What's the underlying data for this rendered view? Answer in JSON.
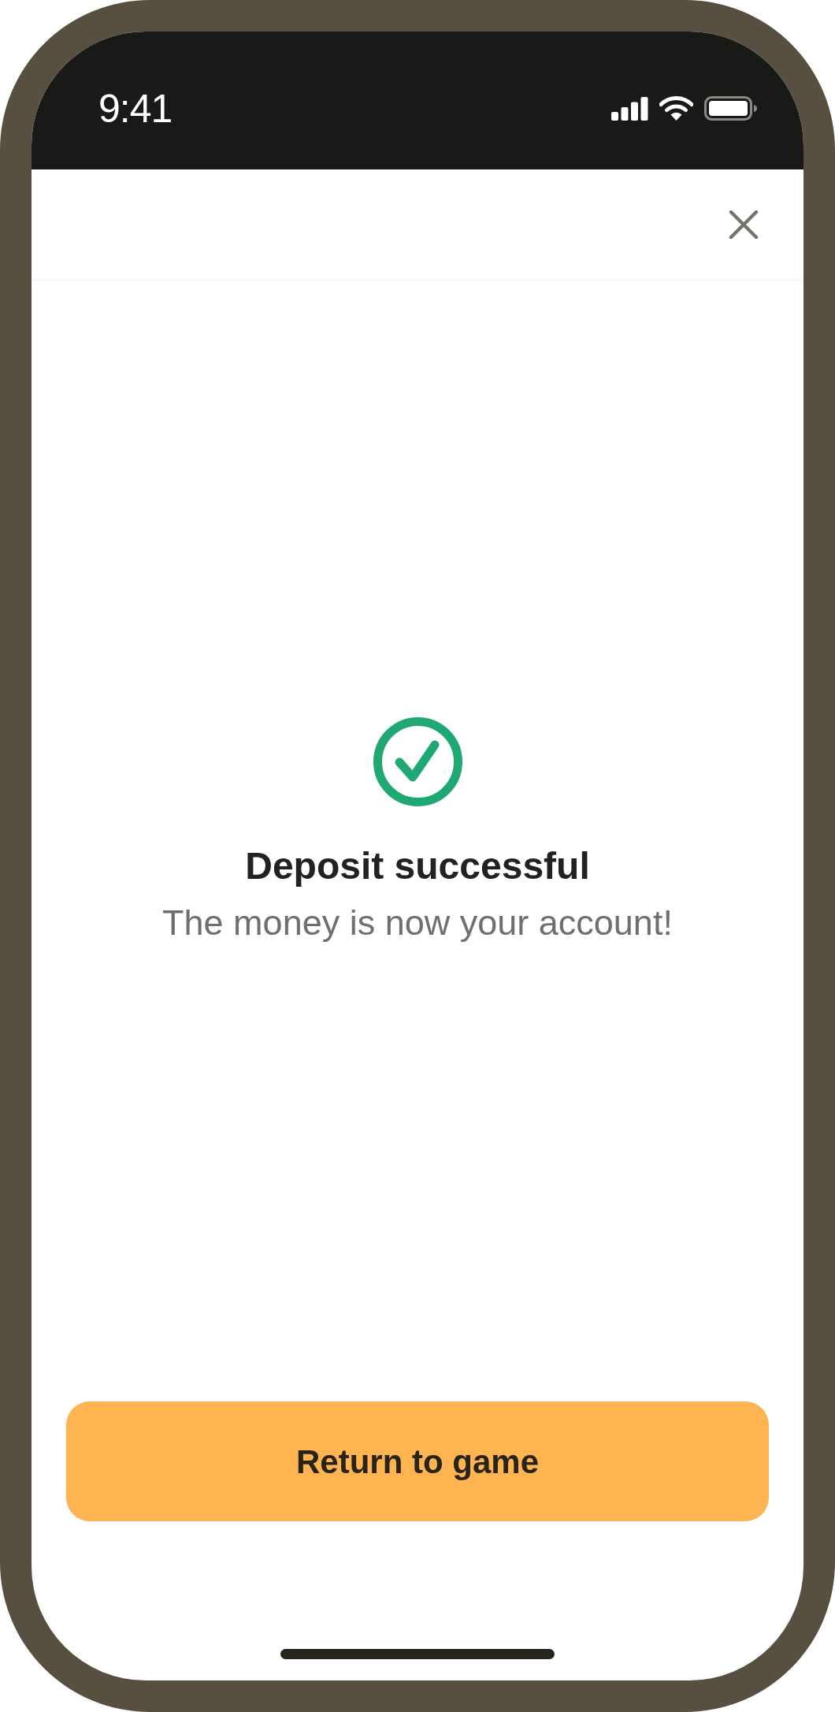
{
  "status_bar": {
    "time": "9:41"
  },
  "result": {
    "title": "Deposit successful",
    "message": "The money is now your account!"
  },
  "primary_button": {
    "label": "Return to game"
  }
}
